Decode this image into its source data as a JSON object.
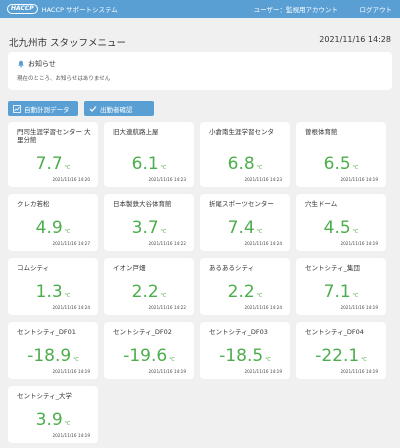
{
  "header": {
    "logo": "HACCP",
    "app_title": "HACCP サポートシステム",
    "user": "ユーザー：監視用アカウント",
    "logout": "ログアウト"
  },
  "page": {
    "title": "北九州市 スタッフメニュー",
    "datetime": "2021/11/16 14:28"
  },
  "notice": {
    "heading": "お知らせ",
    "body": "現在のところ、お知らせはありません"
  },
  "buttons": {
    "measure": "自動計測データ",
    "attendance": "出勤者確認"
  },
  "colors": {
    "header_bg": "#5a9fd4",
    "value_green": "#4cae4c"
  },
  "cards": [
    {
      "name": "門司生涯学習センター 大里分館",
      "value": "7.7",
      "unit": "℃",
      "time": "2021/11/16 14:20"
    },
    {
      "name": "旧大連航路上屋",
      "value": "6.1",
      "unit": "℃",
      "time": "2021/11/16 14:23"
    },
    {
      "name": "小倉南生涯学習センタ",
      "value": "6.8",
      "unit": "℃",
      "time": "2021/11/16 14:23"
    },
    {
      "name": "曽根体育館",
      "value": "6.5",
      "unit": "℃",
      "time": "2021/11/16 14:19"
    },
    {
      "name": "クレカ若松",
      "value": "4.9",
      "unit": "℃",
      "time": "2021/11/16 14:27"
    },
    {
      "name": "日本製鉄大谷体育館",
      "value": "3.7",
      "unit": "℃",
      "time": "2021/11/16 14:22"
    },
    {
      "name": "折尾スポーツセンター",
      "value": "7.4",
      "unit": "℃",
      "time": "2021/11/16 14:24"
    },
    {
      "name": "穴生ドーム",
      "value": "4.5",
      "unit": "℃",
      "time": "2021/11/16 14:19"
    },
    {
      "name": "コムシティ",
      "value": "1.3",
      "unit": "℃",
      "time": "2021/11/16 14:24"
    },
    {
      "name": "イオン戸畑",
      "value": "2.2",
      "unit": "℃",
      "time": "2021/11/16 14:22"
    },
    {
      "name": "あるあるシティ",
      "value": "2.2",
      "unit": "℃",
      "time": "2021/11/16 14:24"
    },
    {
      "name": "セントシティ_集団",
      "value": "7.1",
      "unit": "℃",
      "time": "2021/11/16 14:19"
    },
    {
      "name": "セントシティ_DF01",
      "value": "-18.9",
      "unit": "℃",
      "time": "2021/11/16 14:19"
    },
    {
      "name": "セントシティ_DF02",
      "value": "-19.6",
      "unit": "℃",
      "time": "2021/11/16 14:19"
    },
    {
      "name": "セントシティ_DF03",
      "value": "-18.5",
      "unit": "℃",
      "time": "2021/11/16 14:19"
    },
    {
      "name": "セントシティ_DF04",
      "value": "-22.1",
      "unit": "℃",
      "time": "2021/11/16 14:19"
    },
    {
      "name": "セントシティ_大学",
      "value": "3.9",
      "unit": "℃",
      "time": "2021/11/16 14:19"
    }
  ]
}
